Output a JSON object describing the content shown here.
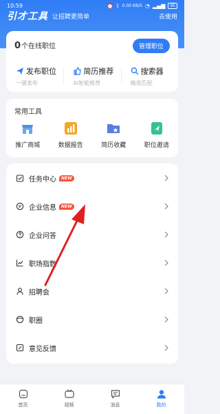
{
  "status_bar": {
    "time": "10:59",
    "speed": "0.00 KB/S",
    "battery": "95"
  },
  "brand": {
    "logo": "引才工具",
    "slogan": "让招聘更简单",
    "go_use": "去使用"
  },
  "job_card": {
    "online_count": "0",
    "online_suffix": "个在线职位",
    "manage_button": "管理职位",
    "actions": [
      {
        "title": "发布职位",
        "sub": "一键发布",
        "icon": "send-icon"
      },
      {
        "title": "简历推荐",
        "sub": "AI智能推荐",
        "icon": "thumbs-up-icon"
      },
      {
        "title": "搜索器",
        "sub": "精准匹配",
        "icon": "search-icon"
      }
    ]
  },
  "tools": {
    "title": "常用工具",
    "items": [
      {
        "label": "推广商城",
        "icon": "store-icon",
        "color": "#4a90e2"
      },
      {
        "label": "数据报告",
        "icon": "chart-icon",
        "color": "#f5a623"
      },
      {
        "label": "简历收藏",
        "icon": "folder-star-icon",
        "color": "#5b7de0"
      },
      {
        "label": "职位邀请",
        "icon": "invite-icon",
        "color": "#34c38f"
      }
    ]
  },
  "menu": {
    "items": [
      {
        "label": "任务中心",
        "badge": "NEW",
        "icon": "task-icon"
      },
      {
        "label": "企业信息",
        "badge": "NEW",
        "icon": "message-icon"
      },
      {
        "label": "企业问答",
        "badge": "",
        "icon": "question-icon"
      },
      {
        "label": "职场指数",
        "badge": "",
        "icon": "trend-icon"
      },
      {
        "label": "招聘会",
        "badge": "",
        "icon": "people-icon"
      },
      {
        "label": "职圈",
        "badge": "",
        "icon": "circle-icon"
      },
      {
        "label": "意见反馈",
        "badge": "",
        "icon": "feedback-icon"
      }
    ]
  },
  "bottom_nav": {
    "items": [
      {
        "label": "首页",
        "icon": "home-icon"
      },
      {
        "label": "视频",
        "icon": "video-icon"
      },
      {
        "label": "消息",
        "icon": "chat-icon"
      },
      {
        "label": "我的",
        "icon": "user-icon",
        "active": true
      }
    ]
  },
  "colors": {
    "primary": "#2f7df6",
    "badge": "#f5533d",
    "arrow": "#e02020"
  }
}
